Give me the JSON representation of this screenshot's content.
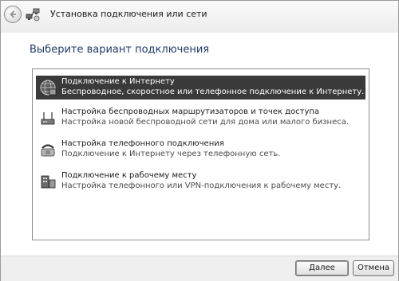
{
  "window": {
    "title": "Установка подключения или сети"
  },
  "main": {
    "heading": "Выберите вариант подключения",
    "options": [
      {
        "title": "Подключение к Интернету",
        "description": "Беспроводное, скоростное или телефонное подключение к Интернету.",
        "icon": "globe-icon",
        "selected": true
      },
      {
        "title": "Настройка беспроводных маршрутизаторов и точек доступа",
        "description": "Настройка новой беспроводной сети для дома или малого бизнеса.",
        "icon": "wireless-router-icon",
        "selected": false
      },
      {
        "title": "Настройка телефонного подключения",
        "description": "Подключение к Интернету через телефонную сеть.",
        "icon": "phone-icon",
        "selected": false
      },
      {
        "title": "Подключение к рабочему месту",
        "description": "Настройка телефонного или VPN-подключения к рабочему месту.",
        "icon": "workplace-icon",
        "selected": false
      }
    ]
  },
  "footer": {
    "next_label": "Далее",
    "cancel_label": "Отмена"
  }
}
